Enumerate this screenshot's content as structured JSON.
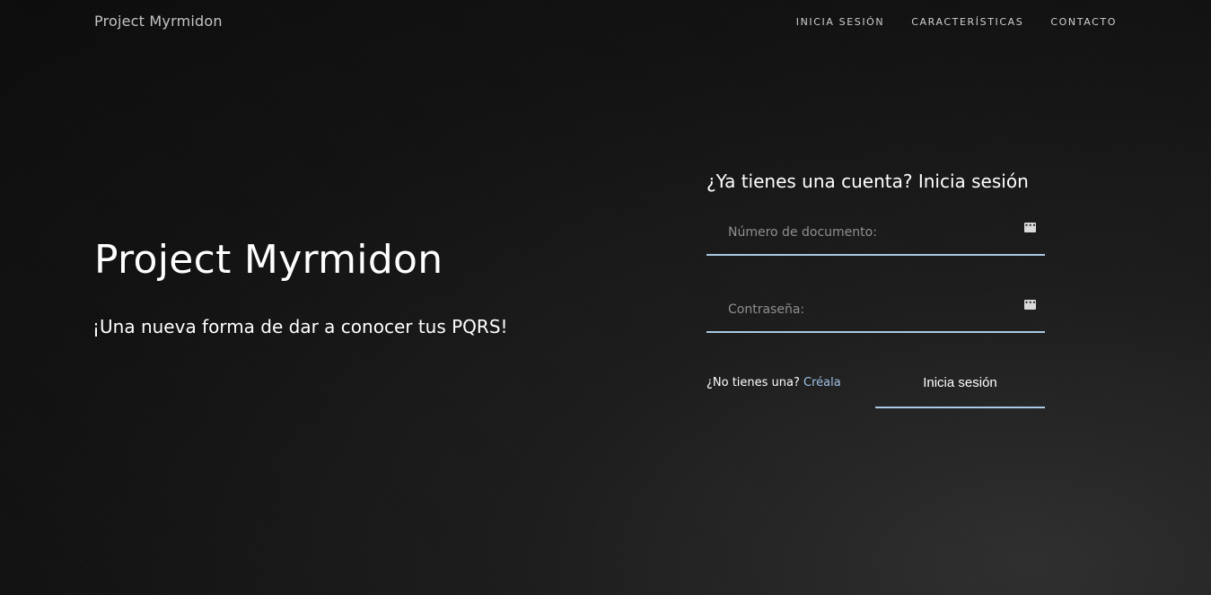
{
  "header": {
    "brand": "Project Myrmidon",
    "nav": [
      "INICIA SESIÓN",
      "CARACTERÍSTICAS",
      "CONTACTO"
    ]
  },
  "hero": {
    "title": "Project Myrmidon",
    "subtitle": "¡Una nueva forma de dar a conocer tus PQRS!"
  },
  "login": {
    "title": "¿Ya tienes una cuenta? Inicia sesión",
    "document_placeholder": "Número de documento:",
    "document_value": "",
    "password_placeholder": "Contraseña:",
    "password_value": "",
    "signup_text": "¿No tienes una?",
    "signup_link": "Créala",
    "submit_label": "Inicia sesión",
    "field_icon": "password-manager-icon",
    "accent_color": "#aac8e4",
    "link_color": "#9fc2e6"
  }
}
